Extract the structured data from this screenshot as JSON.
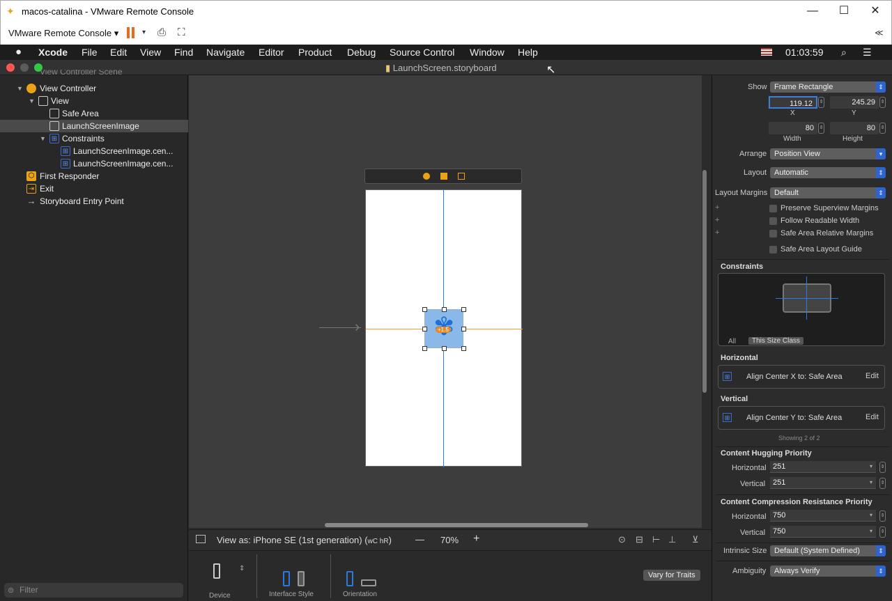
{
  "window": {
    "title": "macos-catalina - VMware Remote Console",
    "minimize": "—",
    "maximize": "☐",
    "close": "✕"
  },
  "vmrc": {
    "menu_label": "VMware Remote Console ▾",
    "collapse": "≪"
  },
  "menubar": {
    "apple": "",
    "items": [
      "Xcode",
      "File",
      "Edit",
      "View",
      "Find",
      "Navigate",
      "Editor",
      "Product",
      "Debug",
      "Source Control",
      "Window",
      "Help"
    ],
    "time": "01:03:59"
  },
  "xcode": {
    "file_title": "LaunchScreen.storyboard"
  },
  "navigator": {
    "scene_header": "View Controller Scene",
    "items": [
      {
        "label": "View Controller"
      },
      {
        "label": "View"
      },
      {
        "label": "Safe Area"
      },
      {
        "label": "LaunchScreenImage"
      },
      {
        "label": "Constraints"
      },
      {
        "label": "LaunchScreenImage.cen..."
      },
      {
        "label": "LaunchScreenImage.cen..."
      },
      {
        "label": "First Responder"
      },
      {
        "label": "Exit"
      },
      {
        "label": "Storyboard Entry Point"
      }
    ],
    "filter_placeholder": "Filter"
  },
  "canvas": {
    "badge": "+1.5"
  },
  "bottom_bar": {
    "view_as": "View as: iPhone SE (1st generation) (",
    "size_class": "wC hR",
    "view_as_end": ")",
    "zoom_out": "—",
    "zoom": "70%",
    "zoom_in": "+"
  },
  "device_bar": {
    "device": "Device",
    "interface_style": "Interface Style",
    "orientation": "Orientation",
    "vary": "Vary for Traits"
  },
  "inspector": {
    "show_label": "Show",
    "show_value": "Frame Rectangle",
    "x": "119.12",
    "x_label": "X",
    "y": "245.29",
    "y_label": "Y",
    "width": "80",
    "width_label": "Width",
    "height": "80",
    "height_label": "Height",
    "arrange_label": "Arrange",
    "arrange_value": "Position View",
    "layout_label": "Layout",
    "layout_value": "Automatic",
    "margins_label": "Layout Margins",
    "margins_value": "Default",
    "checks": [
      "Preserve Superview Margins",
      "Follow Readable Width",
      "Safe Area Relative Margins",
      "Safe Area Layout Guide"
    ],
    "constraints_title": "Constraints",
    "tab_all": "All",
    "tab_size_class": "This Size Class",
    "horizontal_title": "Horizontal",
    "horizontal_row": "Align Center X to:  Safe Area",
    "vertical_title": "Vertical",
    "vertical_row": "Align Center Y to:  Safe Area",
    "edit": "Edit",
    "showing": "Showing 2 of 2",
    "hugging_title": "Content Hugging Priority",
    "horizontal_label": "Horizontal",
    "vertical_label": "Vertical",
    "hug_h": "251",
    "hug_v": "251",
    "compression_title": "Content Compression Resistance Priority",
    "comp_h": "750",
    "comp_v": "750",
    "intrinsic_label": "Intrinsic Size",
    "intrinsic_value": "Default (System Defined)",
    "ambiguity_label": "Ambiguity",
    "ambiguity_value": "Always Verify"
  }
}
